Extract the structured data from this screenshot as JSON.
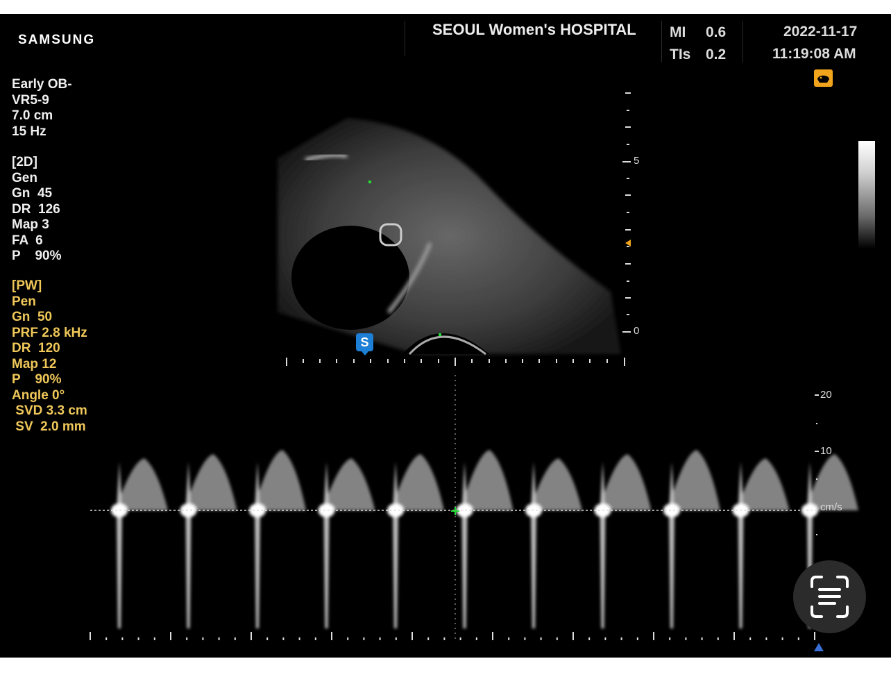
{
  "header": {
    "brand": "SAMSUNG",
    "hospital": "SEOUL Women's HOSPITAL",
    "mi_label": "MI",
    "mi_value": "0.6",
    "tis_label": "TIs",
    "tis_value": "0.2",
    "date": "2022-11-17",
    "time": "11:19:08 AM"
  },
  "preset": [
    "Early OB-",
    "VR5-9",
    "7.0 cm",
    "15 Hz"
  ],
  "mode_2d": [
    "[2D]",
    "Gen",
    "Gn  45",
    "DR  126",
    "Map 3",
    "FA  6",
    "P    90%"
  ],
  "mode_pw": [
    "[PW]",
    "Pen",
    "Gn  50",
    "PRF 2.8 kHz",
    "DR  120",
    "Map 12",
    "P    90%",
    "Angle 0°",
    " SVD 3.3 cm",
    " SV  2.0 mm"
  ],
  "depth_scale": {
    "labels": [
      "5",
      "0"
    ]
  },
  "velocity_scale": {
    "labels": [
      "20",
      "10",
      "cm/s"
    ]
  },
  "sample_marker": "S",
  "colors": {
    "pw_text": "#f0c85a",
    "sv_marker": "#1d7fd6",
    "probe_icon": "#f2a51c",
    "crosshair": "#22dd33"
  },
  "icons": {
    "probe": "probe-orientation-icon",
    "scan": "text-scan-icon"
  }
}
